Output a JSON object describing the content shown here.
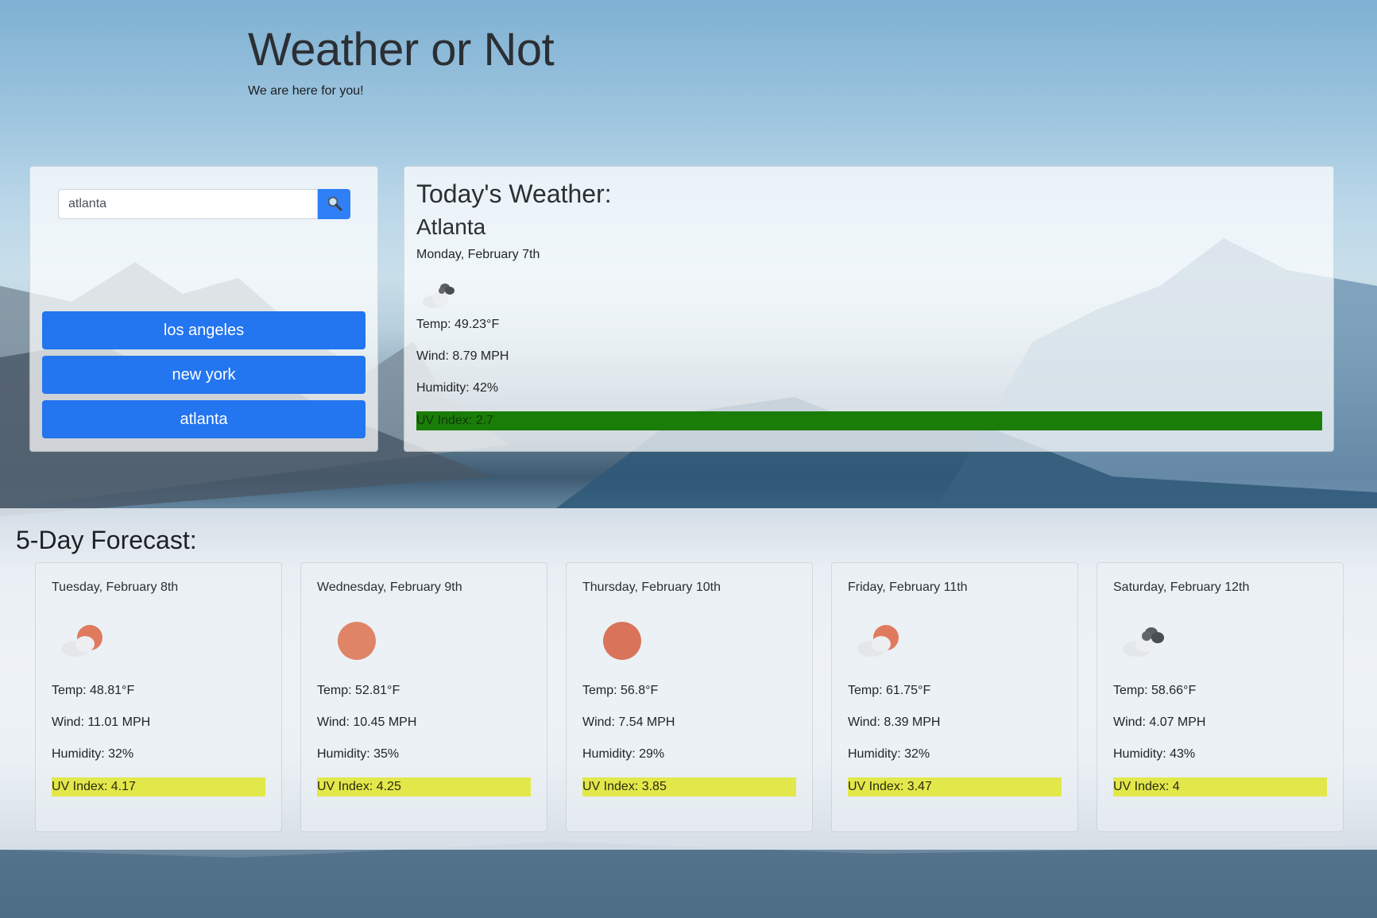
{
  "header": {
    "title": "Weather or Not",
    "subtitle": "We are here for you!"
  },
  "search": {
    "value": "atlanta",
    "button_icon": "search-icon"
  },
  "history": [
    "los angeles",
    "new york",
    "atlanta"
  ],
  "today": {
    "heading": "Today's Weather:",
    "city": "Atlanta",
    "date": "Monday, February 7th",
    "icon": "cloudy-icon",
    "temp": "Temp: 49.23°F",
    "wind": "Wind: 8.79 MPH",
    "humidity": "Humidity: 42%",
    "uv": "UV Index: 2.7",
    "uv_color": "#1a7d08"
  },
  "forecast": {
    "heading": "5-Day Forecast:",
    "uv_color": "#e2e84a",
    "days": [
      {
        "date": "Tuesday, February 8th",
        "icon": "partly-sunny-icon",
        "temp": "Temp: 48.81°F",
        "wind": "Wind: 11.01 MPH",
        "humidity": "Humidity: 32%",
        "uv": "UV Index: 4.17"
      },
      {
        "date": "Wednesday, February 9th",
        "icon": "sun-icon",
        "temp": "Temp: 52.81°F",
        "wind": "Wind: 10.45 MPH",
        "humidity": "Humidity: 35%",
        "uv": "UV Index: 4.25"
      },
      {
        "date": "Thursday, February 10th",
        "icon": "sun-icon",
        "temp": "Temp: 56.8°F",
        "wind": "Wind: 7.54 MPH",
        "humidity": "Humidity: 29%",
        "uv": "UV Index: 3.85"
      },
      {
        "date": "Friday, February 11th",
        "icon": "partly-sunny-icon",
        "temp": "Temp: 61.75°F",
        "wind": "Wind: 8.39 MPH",
        "humidity": "Humidity: 32%",
        "uv": "UV Index: 3.47"
      },
      {
        "date": "Saturday, February 12th",
        "icon": "cloudy-icon",
        "temp": "Temp: 58.66°F",
        "wind": "Wind: 4.07 MPH",
        "humidity": "Humidity: 43%",
        "uv": "UV Index: 4"
      }
    ]
  }
}
